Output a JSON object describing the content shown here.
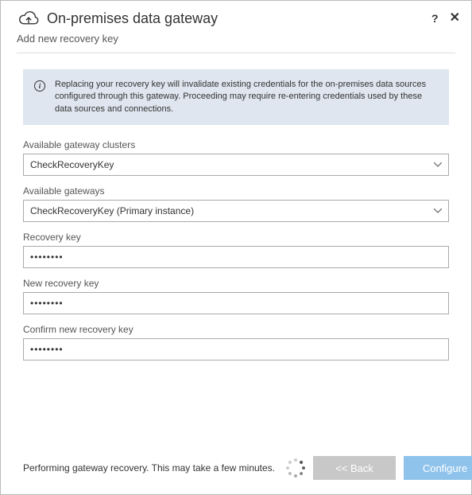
{
  "header": {
    "title": "On-premises data gateway",
    "subtitle": "Add new recovery key"
  },
  "info": {
    "text": "Replacing your recovery key will invalidate existing credentials for the on-premises data sources configured through this gateway. Proceeding may require re-entering credentials used by these data sources and connections."
  },
  "fields": {
    "clusters": {
      "label": "Available gateway clusters",
      "value": "CheckRecoveryKey"
    },
    "gateways": {
      "label": "Available gateways",
      "value": "CheckRecoveryKey",
      "suffix": " (Primary instance)"
    },
    "recovery": {
      "label": "Recovery key",
      "value": "••••••••"
    },
    "newRecovery": {
      "label": "New recovery key",
      "value": "••••••••"
    },
    "confirmRecovery": {
      "label": "Confirm new recovery key",
      "value": "••••••••"
    }
  },
  "footer": {
    "status": "Performing gateway recovery. This may take a few minutes.",
    "back": "<< Back",
    "configure": "Configure"
  }
}
